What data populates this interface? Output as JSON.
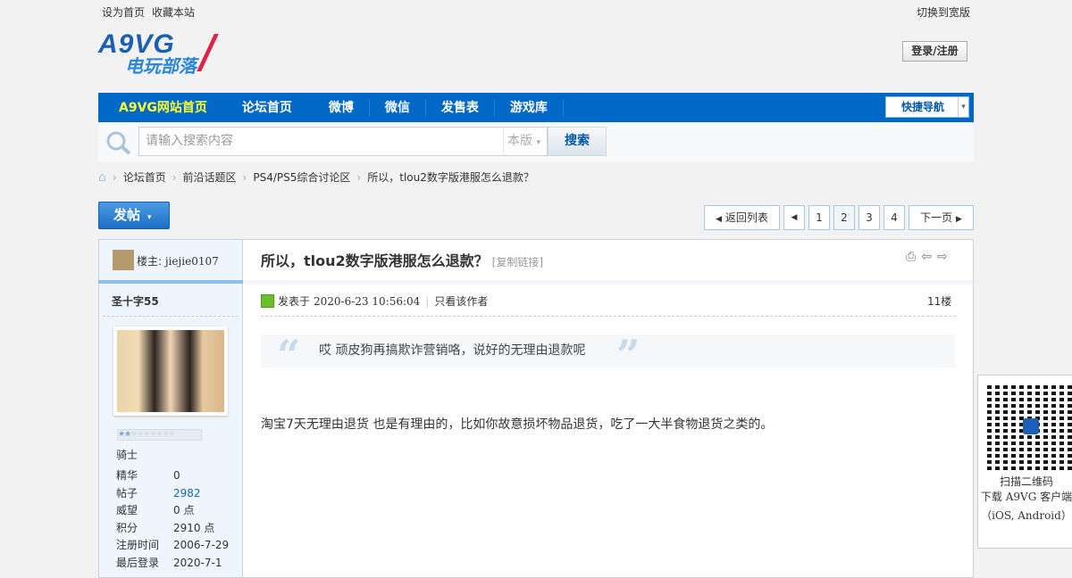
{
  "topbar": {
    "set_home": "设为首页",
    "bookmark": "收藏本站",
    "switch_wide": "切换到宽版"
  },
  "logo": {
    "text_en": "A9VG",
    "text_cn": "电玩部落"
  },
  "login_label": "登录/注册",
  "nav": {
    "items": [
      "A9VG网站首页",
      "论坛首页",
      "微博",
      "微信",
      "发售表",
      "游戏库"
    ],
    "quick_nav": "快捷导航"
  },
  "search": {
    "placeholder": "请输入搜索内容",
    "scope": "本版",
    "button": "搜索"
  },
  "breadcrumb": [
    "论坛首页",
    "前沿话题区",
    "PS4/PS5综合讨论区",
    "所以，tlou2数字版港服怎么退款？"
  ],
  "post_button": "发帖",
  "pagination": {
    "back": "返回列表",
    "pages": [
      "1",
      "2",
      "3",
      "4"
    ],
    "current": "2",
    "next": "下一页"
  },
  "thread": {
    "title": "所以，tlou2数字版港服怎么退款？",
    "copy_link": "[复制链接]"
  },
  "op": {
    "label": "楼主:",
    "name": "jiejie0107"
  },
  "author": {
    "name": "圣十字55",
    "rank": "骑士",
    "stats": [
      {
        "k": "精华",
        "v": "0"
      },
      {
        "k": "帖子",
        "v": "2982"
      },
      {
        "k": "威望",
        "v": "0 点"
      },
      {
        "k": "积分",
        "v": "2910 点"
      },
      {
        "k": "注册时间",
        "v": "2006-7-29"
      },
      {
        "k": "最后登录",
        "v": "2020-7-1"
      }
    ]
  },
  "post": {
    "posted_prefix": "发表于",
    "datetime": "2020-6-23 10:56:04",
    "only_author": "只看该作者",
    "floor": "11楼",
    "quote": "哎 顽皮狗再搞欺诈营销咯，说好的无理由退款呢",
    "content": "淘宝7天无理由退货 也是有理由的，比如你故意损坏物品退货，吃了一大半食物退货之类的。"
  },
  "qr": {
    "line1": "扫描二维码",
    "line2": "下载 A9VG 客户端",
    "line3": "（iOS, Android）"
  }
}
